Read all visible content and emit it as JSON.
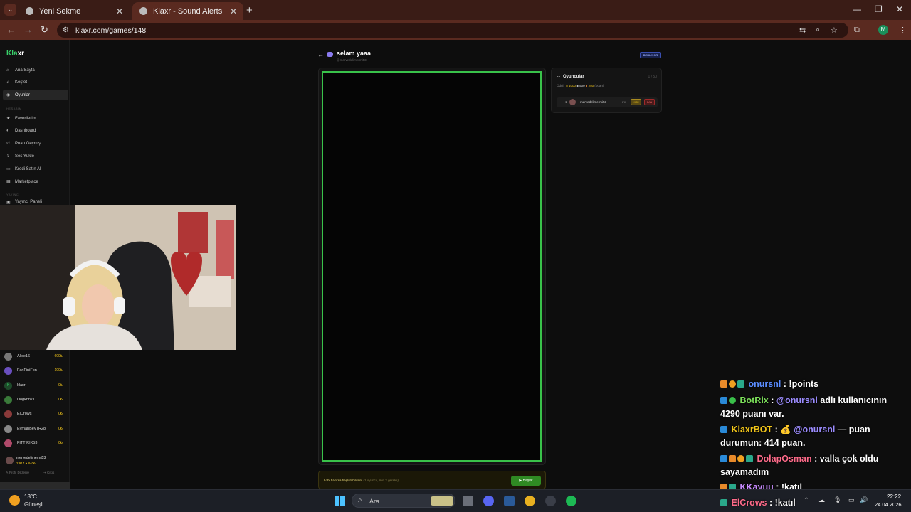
{
  "browser": {
    "tabs": [
      {
        "title": "Yeni Sekme"
      },
      {
        "title": "Klaxr - Sound Alerts"
      }
    ],
    "url": "klaxr.com/games/148",
    "profile_initial": "M"
  },
  "sidebar": {
    "logo_prefix": "Kla",
    "logo_suffix": "xr",
    "items": [
      {
        "label": "Ana Sayfa"
      },
      {
        "label": "Keşfet"
      },
      {
        "label": "Oyunlar"
      },
      {
        "label": "Favorilerim"
      },
      {
        "label": "Dashboard"
      },
      {
        "label": "Puan Geçmişi"
      },
      {
        "label": "Ses Yükle"
      },
      {
        "label": "Kredi Satın Al"
      },
      {
        "label": "Marketplace"
      }
    ],
    "section_account": "HESABIM",
    "section_broadcaster": "YAYINCI",
    "partial_item": "Yayıncı Paneli",
    "leaderboard": [
      {
        "name": "Alice16",
        "points": "600₺"
      },
      {
        "name": "FanFiniFon",
        "points": "100₺"
      },
      {
        "name": "klaxr",
        "points": "0₺"
      },
      {
        "name": "Dogknn71",
        "points": "0₺"
      },
      {
        "name": "ElCrows",
        "points": "0₺"
      },
      {
        "name": "EymanBeyTR28",
        "points": "0₺"
      },
      {
        "name": "FITTIRIK53",
        "points": "0₺"
      }
    ],
    "user": {
      "name": "mervedelimermi53",
      "stats": "2.917 ● 840₺"
    },
    "profile_edit": "Profil Düzenle",
    "logout": "Çıkış"
  },
  "game": {
    "title": "selam yaaa",
    "subtitle": "@mervedelimermi53",
    "status": "BEKLIYOR",
    "players_panel": {
      "title": "Oyuncular",
      "count": "1 / 50",
      "prize_label": "Ödül:",
      "prizes": [
        "1000",
        "500",
        "250"
      ],
      "prize_unit": "(puan)",
      "player": {
        "rank": "1",
        "name": "mervedelimermi53",
        "pct": "0%",
        "kick": "KICK",
        "ban": "BAN"
      }
    },
    "lobby": {
      "text": "Lobi hazırsa başlatabilirsin.",
      "hint": "(1 oyuncu, min 2 gerekli)",
      "start_label": "Başlat"
    }
  },
  "chat": {
    "messages": [
      {
        "user": "onursnl",
        "color": "#5a8cff",
        "text": " : !points"
      },
      {
        "user": "BotRix",
        "color": "#7ce05a",
        "text": " : ",
        "mention": "@onursnl",
        "rest": " adlı kullanıcının 4290 puanı var."
      },
      {
        "user": "KlaxrBOT",
        "color": "#f0c419",
        "text": " : 💰 ",
        "mention": "@onursnl",
        "rest": " — puan durumun: 414 puan."
      },
      {
        "user": "DolapOsman",
        "color": "#ff6b8a",
        "text": " : valla çok oldu sayamadım"
      },
      {
        "user": "KKayuu",
        "color": "#c88bff",
        "text": " : !katıl"
      },
      {
        "user": "ElCrows",
        "color": "#ff6b8a",
        "text": " : !katıl"
      }
    ]
  },
  "taskbar": {
    "weather_temp": "18°C",
    "weather_desc": "Güneşli",
    "search_label": "Ara",
    "time": "22:22",
    "date": "24.04.2026"
  },
  "colors": {
    "accent_green": "#39c24a",
    "gold": "#f0c419",
    "browser_frame": "#5a2a20"
  }
}
